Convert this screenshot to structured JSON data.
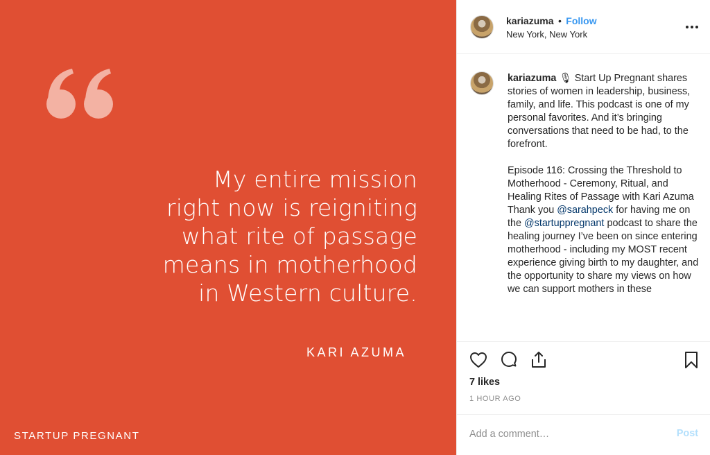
{
  "image": {
    "quote_lines": [
      "My entire mission",
      "right now is reigniting",
      "what rite of passage",
      "means in motherhood",
      "in Western culture."
    ],
    "author": "KARI AZUMA",
    "brand": "STARTUP PREGNANT",
    "background_color": "#e04f33"
  },
  "header": {
    "username": "kariazuma",
    "separator": "•",
    "follow_label": "Follow",
    "location": "New York, New York",
    "more_icon": "ellipsis-icon"
  },
  "caption": {
    "username": "kariazuma",
    "emoji": "🎙",
    "intro": "Start Up Pregnant shares stories of women in leadership, business, family, and life. This podcast is one of my personal favorites. And it’s bringing conversations that need to be had, to the forefront.",
    "episode": "Episode 116: Crossing the Threshold to Motherhood - Ceremony, Ritual, and Healing Rites of Passage with Kari Azuma",
    "thanks_prefix": "Thank you",
    "mention_1": "@sarahpeck",
    "thanks_middle": "for having me on the",
    "mention_2": "@startuppregnant",
    "thanks_suffix": "podcast to share the healing journey I’ve been on since entering motherhood - including my MOST recent experience giving birth to my daughter, and the opportunity to share my views on how we can support mothers in these"
  },
  "actions": {
    "icons": [
      "heart-icon",
      "comment-icon",
      "share-icon",
      "bookmark-icon"
    ]
  },
  "likes": "7 likes",
  "timestamp": "1 HOUR AGO",
  "comment": {
    "placeholder": "Add a comment…",
    "post_label": "Post"
  },
  "colors": {
    "accent": "#3897f0",
    "mention": "#003569",
    "post_disabled": "#b2dffc"
  }
}
